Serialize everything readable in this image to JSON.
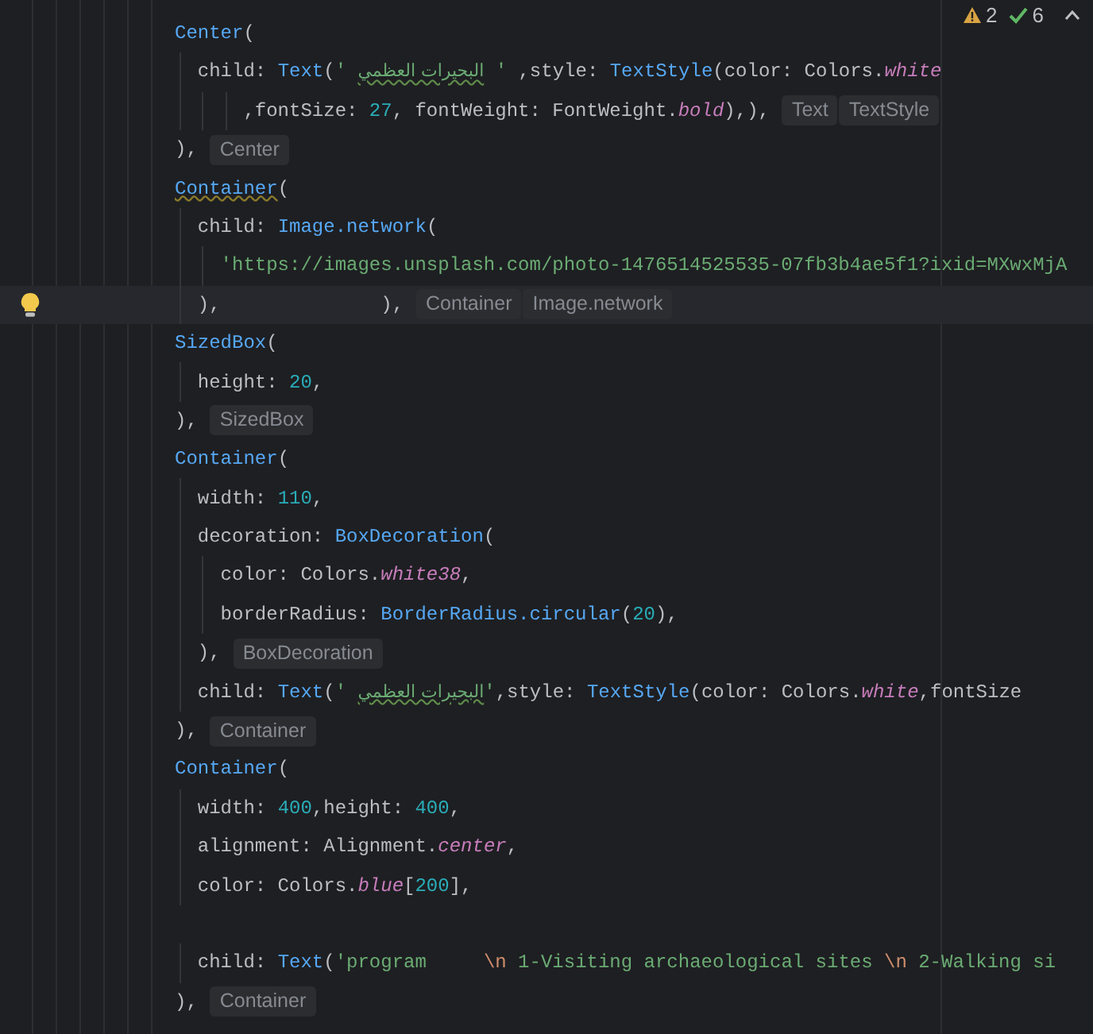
{
  "inspections": [
    {
      "kind": "warning",
      "count": "2"
    },
    {
      "kind": "ok",
      "count": "6"
    }
  ],
  "lines": [
    {
      "kind": "code",
      "tokens": [
        {
          "kind": "class",
          "text": "Center"
        },
        {
          "kind": "plain",
          "text": "("
        }
      ]
    },
    {
      "kind": "code",
      "tokens": [
        {
          "kind": "plain",
          "text": "  child: "
        },
        {
          "kind": "class",
          "text": "Text"
        },
        {
          "kind": "plain",
          "text": "("
        },
        {
          "kind": "string",
          "text": "' "
        },
        {
          "kind": "typo",
          "text": "البحيرات العظمي"
        },
        {
          "kind": "string",
          "text": " '"
        },
        {
          "kind": "plain",
          "text": " ,style: "
        },
        {
          "kind": "class",
          "text": "TextStyle"
        },
        {
          "kind": "plain",
          "text": "(color: Colors."
        },
        {
          "kind": "italic",
          "text": "white"
        }
      ]
    },
    {
      "kind": "code",
      "tokens": [
        {
          "kind": "plain",
          "text": "      ,fontSize: "
        },
        {
          "kind": "number",
          "text": "27"
        },
        {
          "kind": "plain",
          "text": ", fontWeight: FontWeight."
        },
        {
          "kind": "italic",
          "text": "bold"
        },
        {
          "kind": "plain",
          "text": "),),"
        }
      ],
      "hints": [
        "Text",
        "TextStyle"
      ]
    },
    {
      "kind": "code",
      "tokens": [
        {
          "kind": "plain",
          "text": "),"
        }
      ],
      "hints": [
        "Center"
      ]
    },
    {
      "kind": "code",
      "tokens": [
        {
          "kind": "warn_class",
          "text": "Container"
        },
        {
          "kind": "plain",
          "text": "("
        }
      ]
    },
    {
      "kind": "code",
      "tokens": [
        {
          "kind": "plain",
          "text": "  child: "
        },
        {
          "kind": "class",
          "text": "Image.network"
        },
        {
          "kind": "plain",
          "text": "("
        }
      ]
    },
    {
      "kind": "code",
      "tokens": [
        {
          "kind": "string",
          "text": "    'https://images.unsplash.com/photo-1476514525535-07fb3b4ae5f1?ixid=MXwxMjA"
        }
      ]
    },
    {
      "kind": "code",
      "current": true,
      "bulb": true,
      "tokens": [
        {
          "kind": "plain",
          "text": "  ),              ),"
        }
      ],
      "hints": [
        "Container",
        "Image.network"
      ]
    },
    {
      "kind": "code",
      "tokens": [
        {
          "kind": "class",
          "text": "SizedBox"
        },
        {
          "kind": "plain",
          "text": "("
        }
      ]
    },
    {
      "kind": "code",
      "tokens": [
        {
          "kind": "plain",
          "text": "  height: "
        },
        {
          "kind": "number",
          "text": "20"
        },
        {
          "kind": "plain",
          "text": ","
        }
      ]
    },
    {
      "kind": "code",
      "tokens": [
        {
          "kind": "plain",
          "text": "),"
        }
      ],
      "hints": [
        "SizedBox"
      ]
    },
    {
      "kind": "code",
      "tokens": [
        {
          "kind": "class",
          "text": "Container"
        },
        {
          "kind": "plain",
          "text": "("
        }
      ]
    },
    {
      "kind": "code",
      "tokens": [
        {
          "kind": "plain",
          "text": "  width: "
        },
        {
          "kind": "number",
          "text": "110"
        },
        {
          "kind": "plain",
          "text": ","
        }
      ]
    },
    {
      "kind": "code",
      "tokens": [
        {
          "kind": "plain",
          "text": "  decoration: "
        },
        {
          "kind": "class",
          "text": "BoxDecoration"
        },
        {
          "kind": "plain",
          "text": "("
        }
      ]
    },
    {
      "kind": "code",
      "tokens": [
        {
          "kind": "plain",
          "text": "    color: Colors."
        },
        {
          "kind": "italic",
          "text": "white38"
        },
        {
          "kind": "plain",
          "text": ","
        }
      ]
    },
    {
      "kind": "code",
      "tokens": [
        {
          "kind": "plain",
          "text": "    borderRadius: "
        },
        {
          "kind": "class",
          "text": "BorderRadius.circular"
        },
        {
          "kind": "plain",
          "text": "("
        },
        {
          "kind": "number",
          "text": "20"
        },
        {
          "kind": "plain",
          "text": "),"
        }
      ]
    },
    {
      "kind": "code",
      "tokens": [
        {
          "kind": "plain",
          "text": "  ),"
        }
      ],
      "hints": [
        "BoxDecoration"
      ]
    },
    {
      "kind": "code",
      "tokens": [
        {
          "kind": "plain",
          "text": "  child: "
        },
        {
          "kind": "class",
          "text": "Text"
        },
        {
          "kind": "plain",
          "text": "("
        },
        {
          "kind": "string",
          "text": "' "
        },
        {
          "kind": "typo",
          "text": "البحيرات العظمي"
        },
        {
          "kind": "string",
          "text": "'"
        },
        {
          "kind": "plain",
          "text": ",style: "
        },
        {
          "kind": "class",
          "text": "TextStyle"
        },
        {
          "kind": "plain",
          "text": "(color: Colors."
        },
        {
          "kind": "italic",
          "text": "white"
        },
        {
          "kind": "plain",
          "text": ",fontSize"
        }
      ]
    },
    {
      "kind": "code",
      "tokens": [
        {
          "kind": "plain",
          "text": "),"
        }
      ],
      "hints": [
        "Container"
      ]
    },
    {
      "kind": "code",
      "tokens": [
        {
          "kind": "class",
          "text": "Container"
        },
        {
          "kind": "plain",
          "text": "("
        }
      ]
    },
    {
      "kind": "code",
      "tokens": [
        {
          "kind": "plain",
          "text": "  width: "
        },
        {
          "kind": "number",
          "text": "400"
        },
        {
          "kind": "plain",
          "text": ",height: "
        },
        {
          "kind": "number",
          "text": "400"
        },
        {
          "kind": "plain",
          "text": ","
        }
      ]
    },
    {
      "kind": "code",
      "tokens": [
        {
          "kind": "plain",
          "text": "  alignment: Alignment."
        },
        {
          "kind": "italic",
          "text": "center"
        },
        {
          "kind": "plain",
          "text": ","
        }
      ]
    },
    {
      "kind": "code",
      "tokens": [
        {
          "kind": "plain",
          "text": "  color: Colors."
        },
        {
          "kind": "italic",
          "text": "blue"
        },
        {
          "kind": "plain",
          "text": "["
        },
        {
          "kind": "number",
          "text": "200"
        },
        {
          "kind": "plain",
          "text": "],"
        }
      ]
    },
    {
      "kind": "blank"
    },
    {
      "kind": "code",
      "tokens": [
        {
          "kind": "plain",
          "text": "  child: "
        },
        {
          "kind": "class",
          "text": "Text"
        },
        {
          "kind": "plain",
          "text": "("
        },
        {
          "kind": "string",
          "text": "'program     "
        },
        {
          "kind": "escape",
          "text": "\\n"
        },
        {
          "kind": "string",
          "text": " 1-Visiting archaeological sites "
        },
        {
          "kind": "escape",
          "text": "\\n"
        },
        {
          "kind": "string",
          "text": " 2-Walking si"
        }
      ]
    },
    {
      "kind": "code",
      "tokens": [
        {
          "kind": "plain",
          "text": "),"
        }
      ],
      "hints": [
        "Container"
      ]
    }
  ]
}
